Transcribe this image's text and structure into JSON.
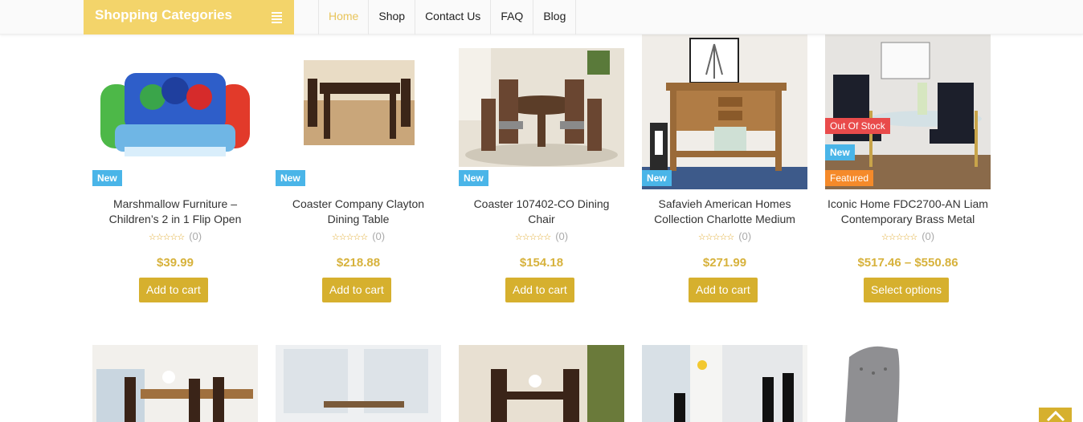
{
  "header": {
    "category_label": "Shopping Categories",
    "nav": [
      {
        "label": "Home",
        "active": true
      },
      {
        "label": "Shop"
      },
      {
        "label": "Contact Us"
      },
      {
        "label": "FAQ"
      },
      {
        "label": "Blog"
      }
    ]
  },
  "products": [
    {
      "title_line1": "Marshmallow Furniture –",
      "title_line2": "Children’s 2 in 1 Flip Open",
      "rating_count": "(0)",
      "price": "$39.99",
      "button": "Add to cart",
      "badges": [
        "New"
      ]
    },
    {
      "title_line1": "Coaster Company Clayton",
      "title_line2": "Dining Table",
      "rating_count": "(0)",
      "price": "$218.88",
      "button": "Add to cart",
      "badges": [
        "New"
      ]
    },
    {
      "title_line1": "Coaster 107402-CO Dining",
      "title_line2": "Chair",
      "rating_count": "(0)",
      "price": "$154.18",
      "button": "Add to cart",
      "badges": [
        "New"
      ]
    },
    {
      "title_line1": "Safavieh American Homes",
      "title_line2": "Collection Charlotte Medium",
      "rating_count": "(0)",
      "price": "$271.99",
      "button": "Add to cart",
      "badges": [
        "New"
      ]
    },
    {
      "title_line1": "Iconic Home FDC2700-AN Liam",
      "title_line2": "Contemporary Brass Metal",
      "rating_count": "(0)",
      "price": "$517.46 – $550.86",
      "button": "Select options",
      "badges": [
        "Out Of Stock",
        "New",
        "Featured"
      ]
    }
  ],
  "stars_glyph": "☆☆☆☆☆",
  "colors": {
    "accent": "#f3d46a",
    "button": "#d6b02e",
    "price": "#d7b23c",
    "badge_new": "#4ab5e8",
    "badge_out_of_stock": "#e94b4b",
    "badge_featured": "#f58a2a"
  }
}
